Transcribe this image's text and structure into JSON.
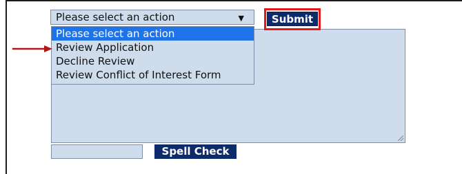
{
  "action_select": {
    "selected": "Please select an action",
    "options": [
      "Please select an action",
      "Review Application",
      "Decline Review",
      "Review Conflict of Interest Form"
    ]
  },
  "buttons": {
    "submit": "Submit",
    "spell_check": "Spell Check"
  },
  "icons": {
    "dropdown_arrow": "triangle-down",
    "pointer": "red-arrow-right"
  },
  "colors": {
    "field_bg": "#cfdcec",
    "button_bg": "#0d2a6b",
    "highlight": "#1e73e8",
    "annotation": "#e01818"
  }
}
